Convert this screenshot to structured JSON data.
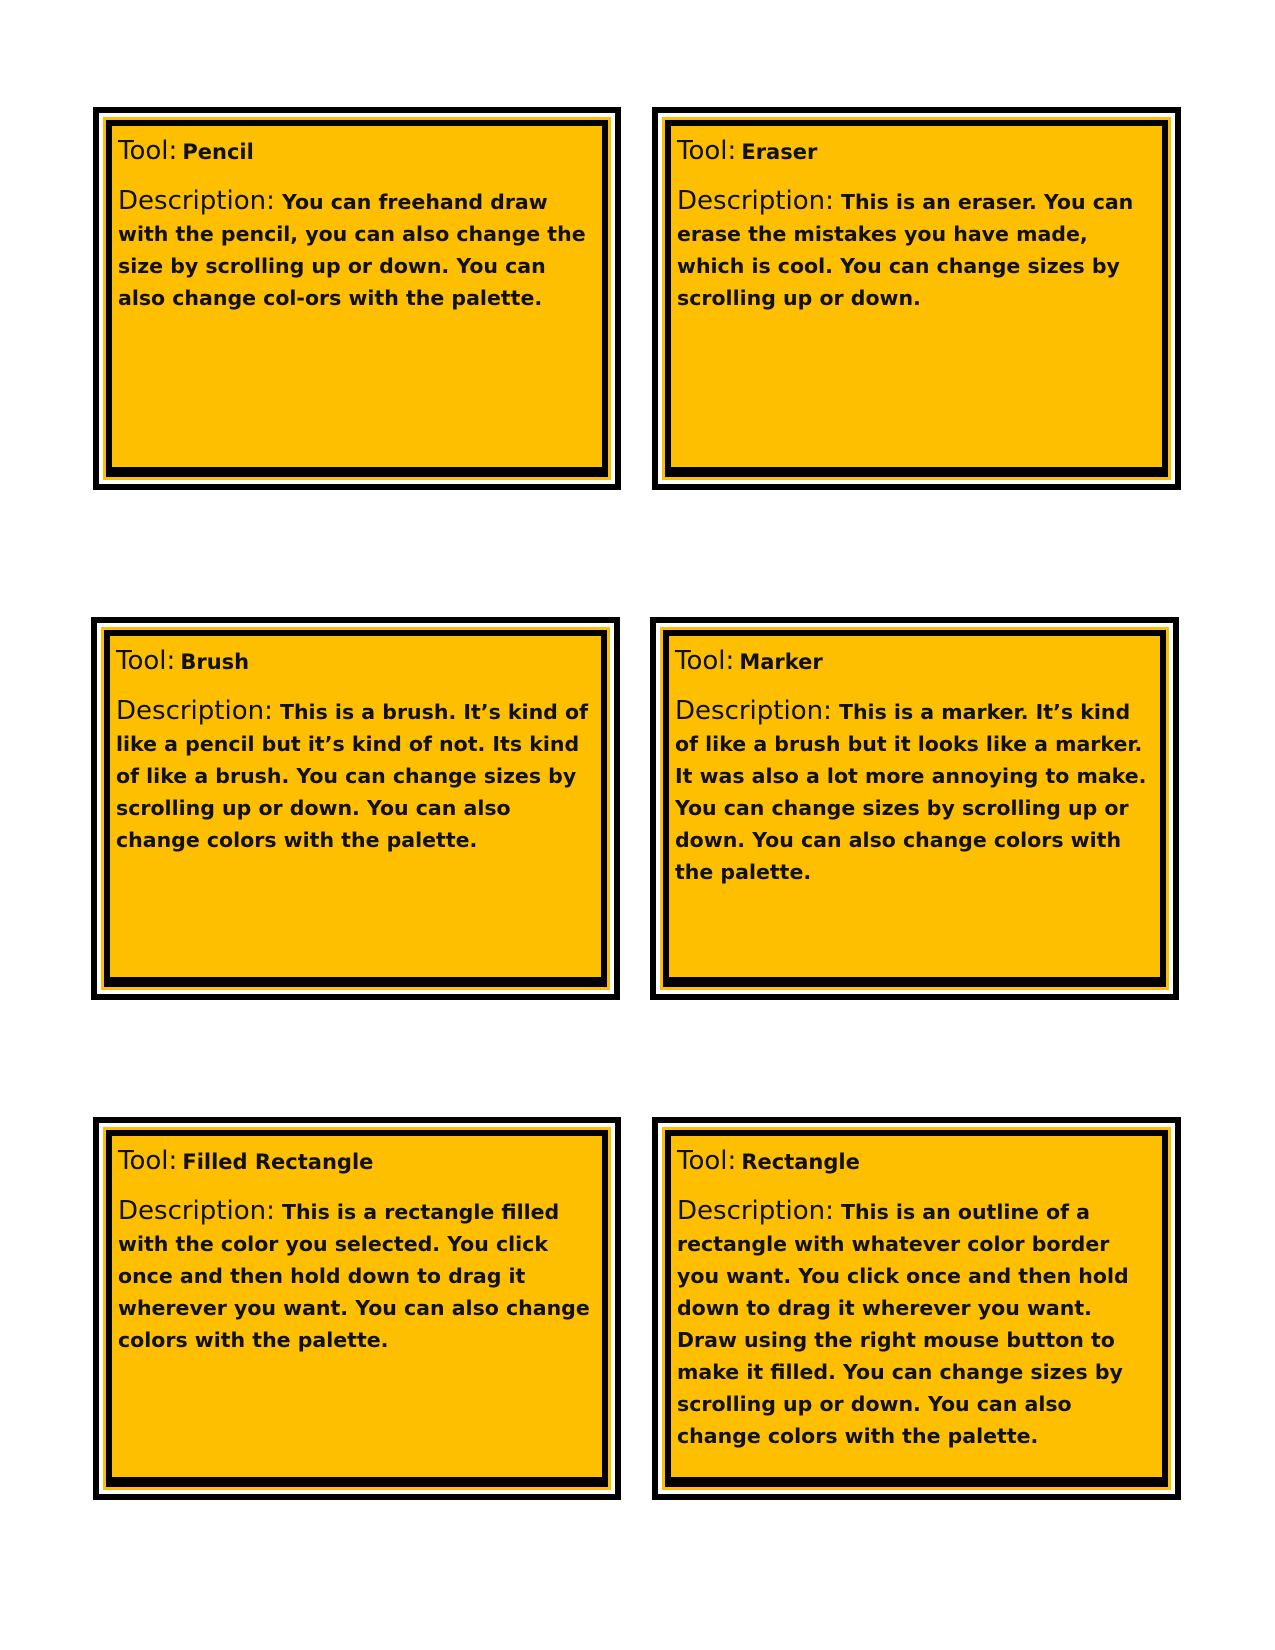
{
  "cards": [
    {
      "tool_label": "Tool:",
      "tool_name": "Pencil",
      "description_label": "Description:",
      "description": "You can freehand draw with the pencil, you can also change the size by scrolling up or down. You can also change col-ors with the palette."
    },
    {
      "tool_label": "Tool:",
      "tool_name": "Eraser",
      "description_label": "Description:",
      "description": "This is an eraser. You can erase the mistakes you have made, which is cool. You can change sizes by scrolling up or down."
    },
    {
      "tool_label": "Tool:",
      "tool_name": "Brush",
      "description_label": "Description:",
      "description": "This is a brush. It’s kind of like a pencil but it’s kind of not. Its kind of like a brush. You can change sizes by scrolling up or down. You can also change colors with the palette."
    },
    {
      "tool_label": "Tool:",
      "tool_name": "Marker",
      "description_label": "Description:",
      "description": "This is a marker. It’s kind of like a brush but it looks like a marker. It was also a lot more annoying to make. You can change sizes by scrolling up or down. You can also change colors with the palette."
    },
    {
      "tool_label": "Tool:",
      "tool_name": "Filled Rectangle",
      "description_label": "Description:",
      "description": "This is a rectangle filled with the color you selected. You click once and then hold down to drag it wherever you want. You can also change colors with the palette."
    },
    {
      "tool_label": "Tool:",
      "tool_name": "Rectangle",
      "description_label": "Description:",
      "description": "This is an outline of a rectangle with whatever color border you want. You click once and then hold down to drag it wherever you want. Draw using the right mouse button to make it filled. You can change sizes by scrolling up or down. You can also change colors with the palette."
    }
  ],
  "colors": {
    "card_fill": "#FDBF00",
    "border": "#000000",
    "page": "#FFFFFF"
  }
}
